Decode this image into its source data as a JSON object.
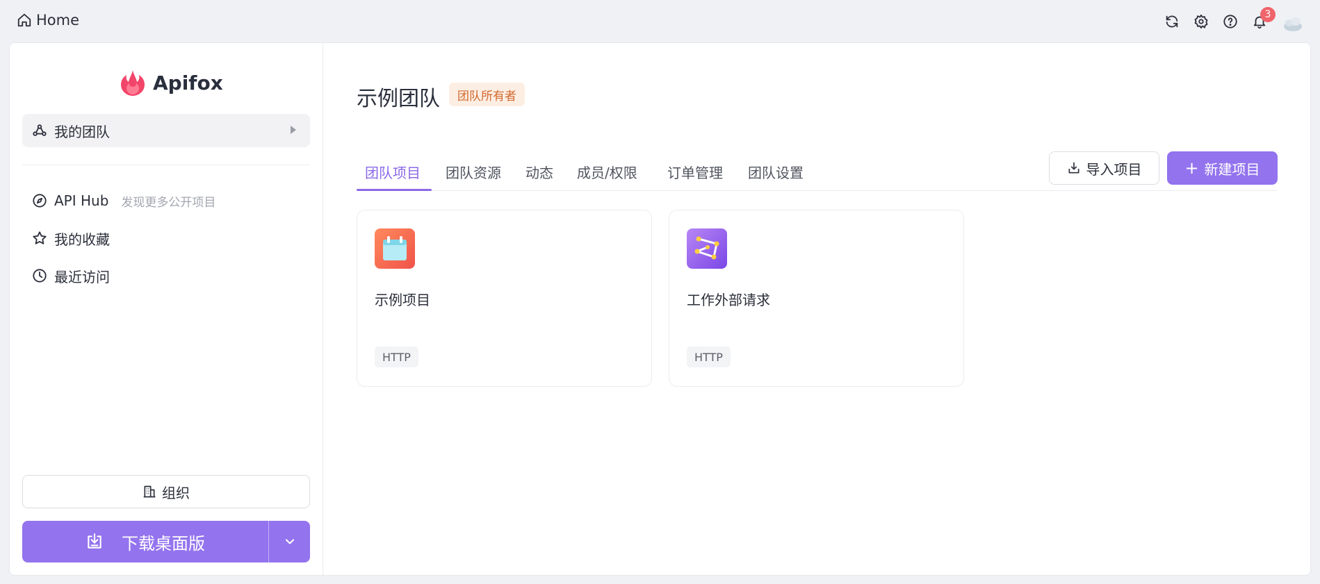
{
  "topbar": {
    "home_label": "Home",
    "notification_count": "3",
    "icons": [
      "refresh-icon",
      "gear-icon",
      "help-icon",
      "bell-icon"
    ]
  },
  "sidebar": {
    "brand": "Apifox",
    "team_item": "我的团队",
    "nav": [
      {
        "label": "API Hub",
        "hint": "发现更多公开项目",
        "icon": "compass-icon"
      },
      {
        "label": "我的收藏",
        "icon": "star-icon"
      },
      {
        "label": "最近访问",
        "icon": "clock-icon"
      }
    ],
    "org_label": "组织",
    "download_label": "下载桌面版"
  },
  "main": {
    "title": "示例团队",
    "role_badge": "团队所有者",
    "tabs": [
      "团队项目",
      "团队资源",
      "动态",
      "成员/权限",
      "订单管理",
      "团队设置"
    ],
    "active_tab": 0,
    "import_label": "导入项目",
    "new_label": "新建项目",
    "projects": [
      {
        "name": "示例项目",
        "protocol": "HTTP",
        "icon": "calendar-project-icon"
      },
      {
        "name": "工作外部请求",
        "protocol": "HTTP",
        "icon": "constellation-project-icon"
      }
    ]
  },
  "colors": {
    "accent": "#9373ee",
    "tab_active": "#8b68e8",
    "badge_bg": "#fdeee3",
    "badge_text": "#d0692e",
    "notify": "#f0656c"
  }
}
